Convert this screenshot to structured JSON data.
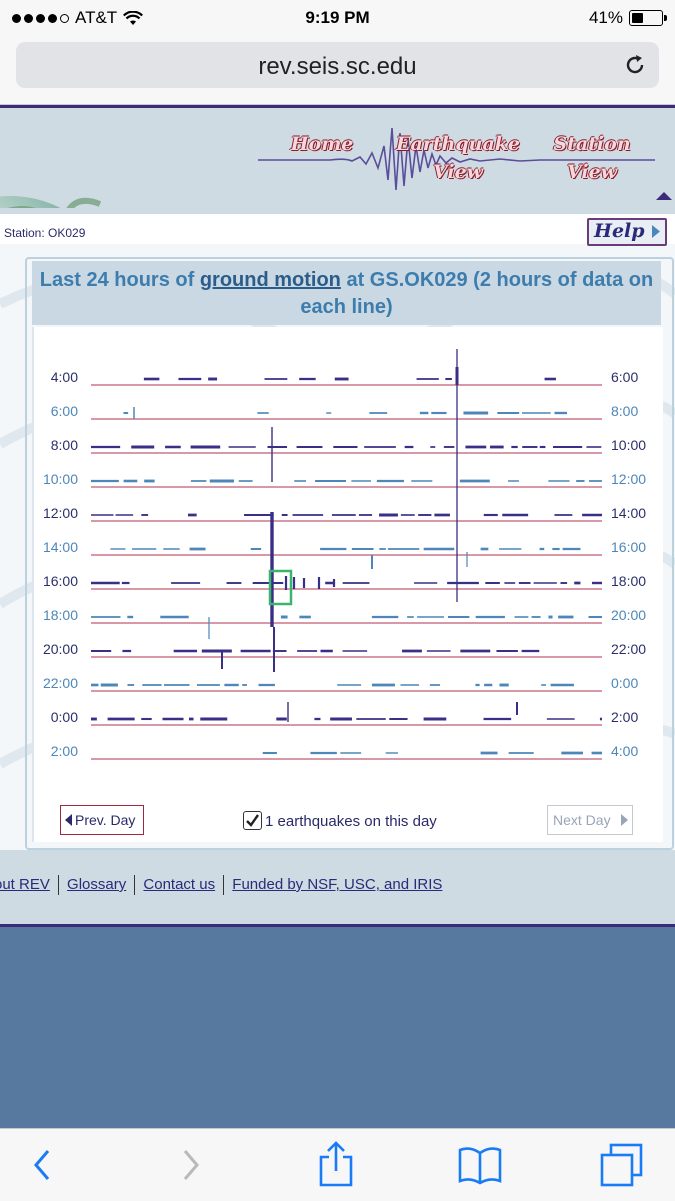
{
  "status_bar": {
    "carrier": "AT&T",
    "time": "9:19 PM",
    "battery": "41%",
    "battery_level": 0.41
  },
  "browser": {
    "url": "rev.seis.sc.edu"
  },
  "site_nav": {
    "home": "Home",
    "earthquake_view_line1": "Earthquake",
    "earthquake_view_line2": "View",
    "station_view_line1": "Station",
    "station_view_line2": "View"
  },
  "station": {
    "label": "Station: OK029",
    "help": "Help"
  },
  "heading": {
    "part1": "Last 24 hours of ",
    "link": "ground motion",
    "part2": " at GS.OK029 (2 hours of data on each line)"
  },
  "seismogram": {
    "left_times": [
      "4:00",
      "6:00",
      "8:00",
      "10:00",
      "12:00",
      "14:00",
      "16:00",
      "18:00",
      "20:00",
      "22:00",
      "0:00",
      "2:00"
    ],
    "right_times": [
      "6:00",
      "8:00",
      "10:00",
      "12:00",
      "14:00",
      "16:00",
      "18:00",
      "20:00",
      "22:00",
      "0:00",
      "2:00",
      "4:00"
    ]
  },
  "controls": {
    "prev_day": "Prev. Day",
    "earthquakes_label": "1 earthquakes on this day",
    "earthquakes_checked": true,
    "next_day": "Next Day"
  },
  "footer": {
    "links": [
      "out REV",
      "Glossary",
      "Contact us",
      "Funded by NSF, USC, and IRIS"
    ]
  },
  "colors": {
    "header_bg": "#cfdbe2",
    "border_purple": "#3b2b78",
    "title_blue": "#3d7dad",
    "trace_dark": "#3a2f86",
    "trace_light": "#4d86b8",
    "baseline_red": "#b03050",
    "highlight_green": "#3cb46e"
  },
  "toolbar": {
    "icons": [
      "back-icon",
      "forward-icon",
      "share-icon",
      "bookmarks-icon",
      "tabs-icon"
    ]
  }
}
